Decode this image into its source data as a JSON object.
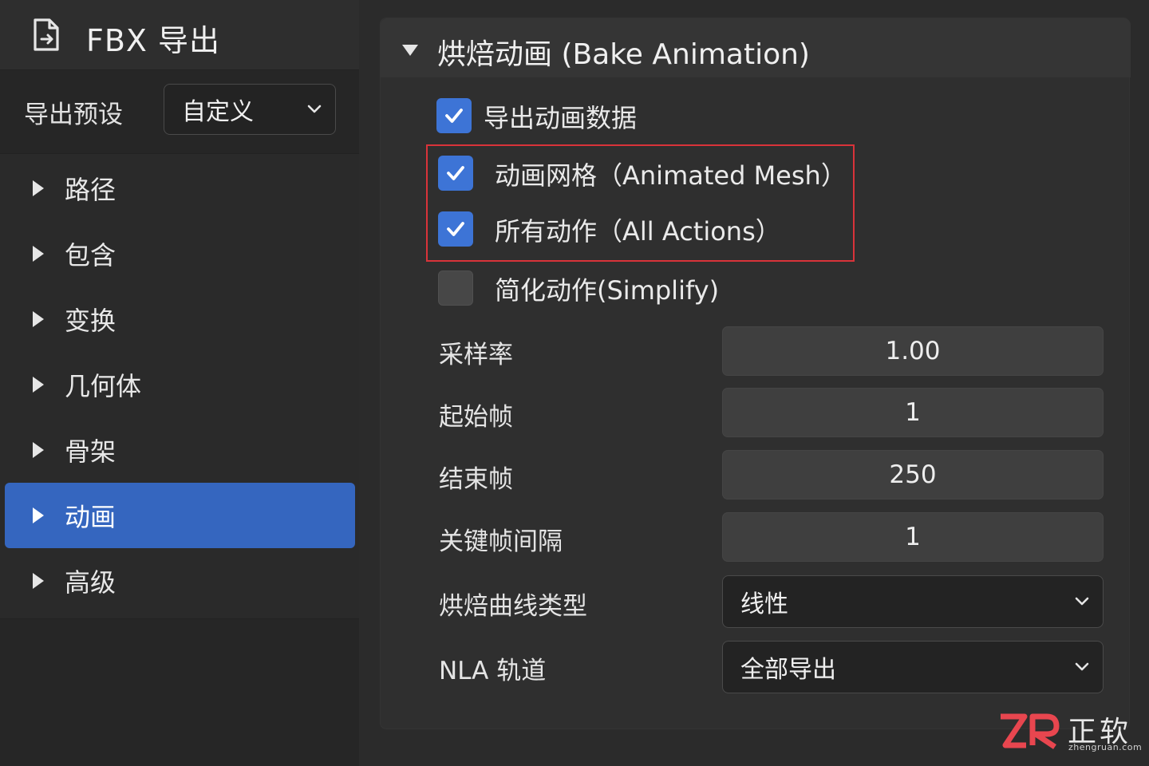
{
  "window": {
    "title": "FBX 导出"
  },
  "preset": {
    "label": "导出预设",
    "value": "自定义"
  },
  "nav": {
    "items": [
      {
        "label": "路径",
        "active": false
      },
      {
        "label": "包含",
        "active": false
      },
      {
        "label": "变换",
        "active": false
      },
      {
        "label": "几何体",
        "active": false
      },
      {
        "label": "骨架",
        "active": false
      },
      {
        "label": "动画",
        "active": true
      },
      {
        "label": "高级",
        "active": false
      }
    ]
  },
  "section": {
    "title": "烘焙动画 (Bake Animation)",
    "checkboxes": [
      {
        "label": "导出动画数据",
        "checked": true
      },
      {
        "label": "动画网格（Animated Mesh）",
        "checked": true
      },
      {
        "label": "所有动作（All Actions）",
        "checked": true
      },
      {
        "label": "简化动作(Simplify)",
        "checked": false
      }
    ],
    "fields": [
      {
        "label": "采样率",
        "value": "1.00"
      },
      {
        "label": "起始帧",
        "value": "1"
      },
      {
        "label": "结束帧",
        "value": "250"
      },
      {
        "label": "关键帧间隔",
        "value": "1"
      }
    ],
    "selects": [
      {
        "label": "烘焙曲线类型",
        "value": "线性"
      },
      {
        "label": "NLA 轨道",
        "value": "全部导出"
      }
    ]
  },
  "watermark": {
    "cn": "正软",
    "en": "zhengruan.com"
  },
  "colors": {
    "accent": "#3566bf",
    "checkbox": "#3d74d6",
    "highlight": "#d9333a"
  }
}
